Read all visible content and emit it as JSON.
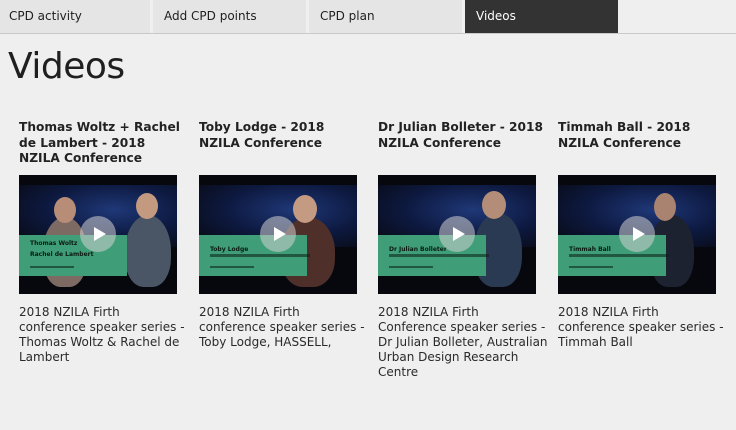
{
  "tabs": [
    {
      "label": "CPD activity"
    },
    {
      "label": "Add CPD points"
    },
    {
      "label": "CPD plan"
    },
    {
      "label": "Videos"
    }
  ],
  "page_title": "Videos",
  "videos": [
    {
      "title": "Thomas Woltz + Rachel de Lambert - 2018 NZILA Conference",
      "overlay_name": "Thomas Woltz\nRachel de Lambert",
      "description": "2018 NZILA Firth conference speaker series - Thomas Woltz & Rachel de Lambert"
    },
    {
      "title": "Toby Lodge - 2018 NZILA Conference",
      "overlay_name": "Toby Lodge",
      "description": "2018 NZILA Firth conference speaker series - Toby Lodge, HASSELL,"
    },
    {
      "title": "Dr Julian Bolleter - 2018 NZILA Conference",
      "overlay_name": "Dr Julian Bolleter",
      "description": "2018 NZILA Firth Conference speaker series - Dr Julian Bolleter, Australian Urban Design Research Centre"
    },
    {
      "title": "Timmah Ball - 2018 NZILA Conference",
      "overlay_name": "Timmah Ball",
      "description": "2018 NZILA Firth conference speaker series - Timmah Ball"
    }
  ],
  "colors": {
    "active_tab": "#333333",
    "overlay_green": "#3f9e78",
    "background": "#efefef"
  }
}
